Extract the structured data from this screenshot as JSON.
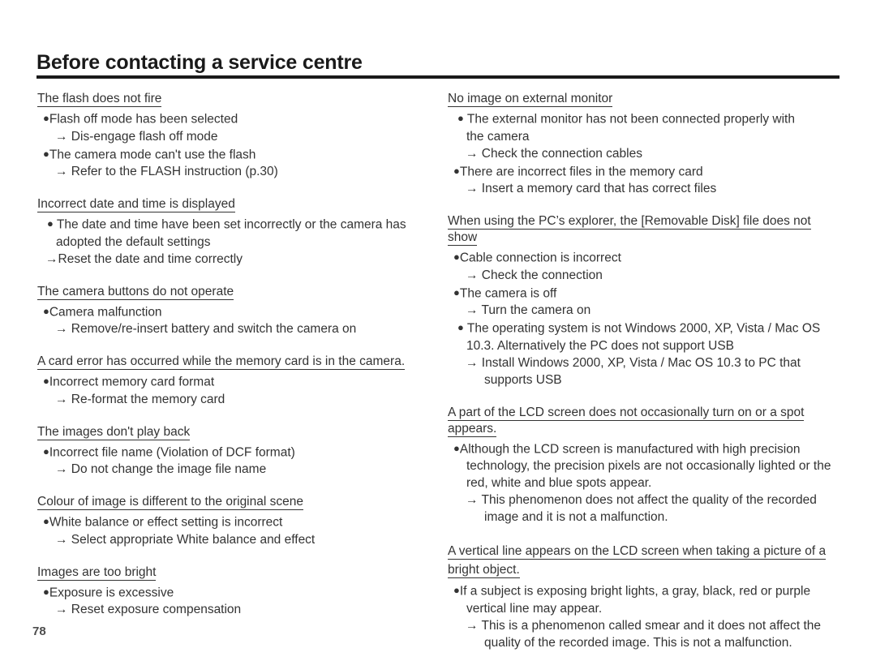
{
  "document": {
    "title": "Before contacting a service centre",
    "page_number": "78"
  },
  "left_column": {
    "sections": [
      {
        "heading": "The flash does not fire",
        "lines": [
          {
            "type": "bullet_tight",
            "text": "Flash off mode has been selected"
          },
          {
            "type": "arrow",
            "text": "Dis-engage flash off mode"
          },
          {
            "type": "bullet_tight",
            "text": "The camera mode can't use the flash"
          },
          {
            "type": "arrow",
            "text": "Refer to the FLASH instruction (p.30)"
          }
        ]
      },
      {
        "heading": "Incorrect date and time is displayed",
        "lines": [
          {
            "type": "bullet_spaced",
            "text": "The date and time have been set incorrectly or the camera has"
          },
          {
            "type": "cont",
            "text": "adopted the default settings"
          },
          {
            "type": "arrow_tight",
            "text": "Reset the date and time correctly"
          }
        ]
      },
      {
        "heading": "The camera buttons do not operate",
        "lines": [
          {
            "type": "bullet_tight",
            "text": "Camera malfunction"
          },
          {
            "type": "arrow",
            "text": "Remove/re-insert battery and switch the camera on"
          }
        ]
      },
      {
        "heading": "A card error has occurred while the memory card is in the camera.",
        "lines": [
          {
            "type": "bullet_tight",
            "text": "Incorrect memory card format"
          },
          {
            "type": "arrow",
            "text": "Re-format the memory card"
          }
        ]
      },
      {
        "heading": "The images don't play back",
        "lines": [
          {
            "type": "bullet_tight",
            "text": "Incorrect file name (Violation of DCF format)"
          },
          {
            "type": "arrow",
            "text": "Do not change the image file name"
          }
        ]
      },
      {
        "heading": "Colour of image is different to the original scene",
        "lines": [
          {
            "type": "bullet_tight",
            "text": "White balance or effect setting is incorrect"
          },
          {
            "type": "arrow",
            "text": "Select appropriate White balance and effect"
          }
        ]
      },
      {
        "heading": "Images are too bright",
        "lines": [
          {
            "type": "bullet_tight",
            "text": "Exposure is excessive"
          },
          {
            "type": "arrow",
            "text": "Reset exposure compensation"
          }
        ]
      }
    ]
  },
  "right_column": {
    "sections": [
      {
        "heading": "No image on external monitor",
        "lines": [
          {
            "type": "bullet_spaced",
            "text": "The external monitor has not been connected properly with"
          },
          {
            "type": "cont",
            "text": "the camera"
          },
          {
            "type": "arrow",
            "text": "Check the connection cables"
          },
          {
            "type": "bullet_tight",
            "text": "There are incorrect files in the memory card"
          },
          {
            "type": "arrow_wide",
            "text": "Insert a memory card that has correct files"
          }
        ]
      },
      {
        "heading": "When using the PC’s explorer, the [Removable Disk] file does not show",
        "lines": [
          {
            "type": "bullet_tight",
            "text": "Cable connection is incorrect"
          },
          {
            "type": "arrow",
            "text": "Check the connection"
          },
          {
            "type": "bullet_tight",
            "text": "The camera is off"
          },
          {
            "type": "arrow",
            "text": "Turn the camera on"
          },
          {
            "type": "bullet_spaced",
            "text": "The operating system is not Windows 2000, XP, Vista / Mac OS"
          },
          {
            "type": "cont",
            "text": "10.3. Alternatively the PC does not support USB"
          },
          {
            "type": "arrow",
            "text": "Install Windows 2000, XP, Vista / Mac OS 10.3 to PC that"
          },
          {
            "type": "cont_deep",
            "text": "supports USB"
          }
        ]
      },
      {
        "heading": "A part of the LCD screen does not occasionally turn on or a spot appears.",
        "lines": [
          {
            "type": "bullet_tight",
            "text": "Although the LCD screen is manufactured with high precision"
          },
          {
            "type": "cont",
            "text": "technology, the precision pixels are not occasionally lighted or the"
          },
          {
            "type": "cont",
            "text": "red, white and blue spots appear."
          },
          {
            "type": "arrow",
            "text": "This phenomenon does not affect the quality of the recorded"
          },
          {
            "type": "cont_deep",
            "text": "image and it is not a malfunction."
          }
        ]
      },
      {
        "heading": "A vertical line appears on the LCD screen when taking a picture of a bright object.",
        "heading_wraps": true,
        "lines": [
          {
            "type": "bullet_tight",
            "text": "If a subject is exposing bright lights, a gray, black, red or purple"
          },
          {
            "type": "cont",
            "text": "vertical line may appear."
          },
          {
            "type": "arrow",
            "text": "This is a phenomenon called smear and it does not affect the"
          },
          {
            "type": "cont_deep",
            "text": "quality of the recorded image. This is not a malfunction."
          }
        ]
      }
    ]
  },
  "glyphs": {
    "bullet": "●",
    "arrow": "→"
  }
}
